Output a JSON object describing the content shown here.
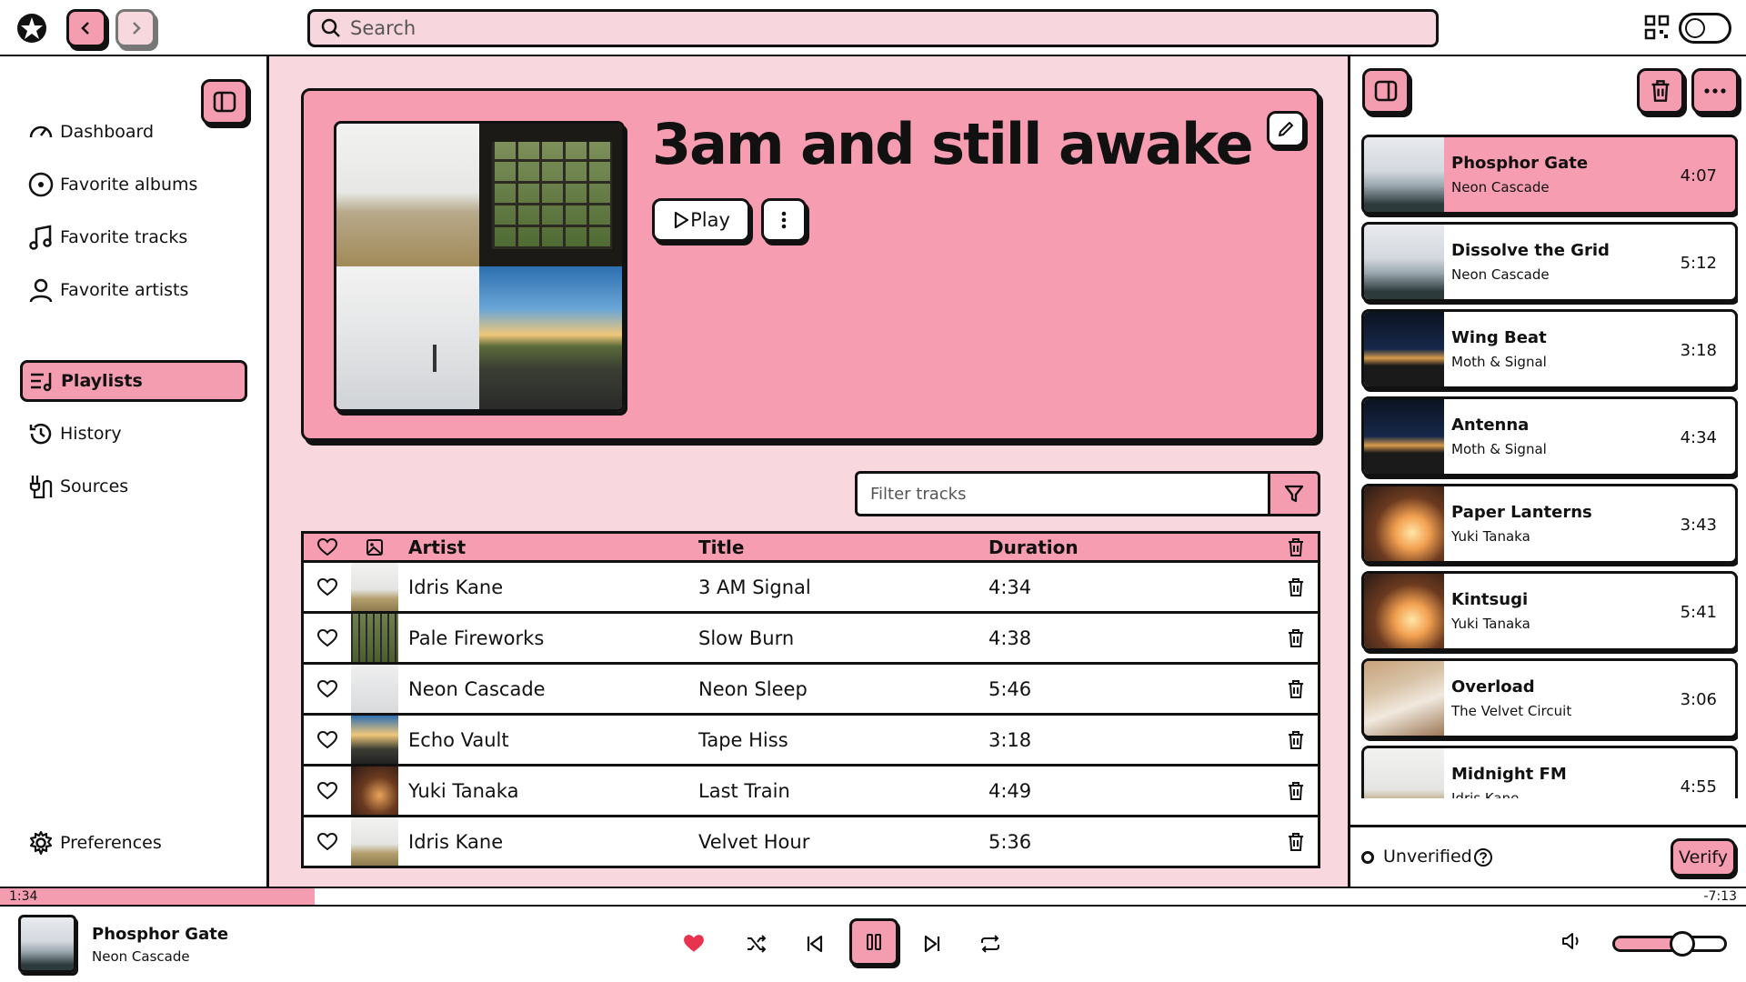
{
  "nav": {
    "search_placeholder": "Search"
  },
  "sidebar": {
    "items": [
      {
        "label": "Dashboard",
        "icon": "gauge-icon"
      },
      {
        "label": "Favorite albums",
        "icon": "disc-icon"
      },
      {
        "label": "Favorite tracks",
        "icon": "music-note-icon"
      },
      {
        "label": "Favorite artists",
        "icon": "user-icon"
      },
      {
        "label": "Playlists",
        "icon": "playlist-icon",
        "active": true
      },
      {
        "label": "History",
        "icon": "history-icon"
      },
      {
        "label": "Sources",
        "icon": "sources-icon"
      }
    ],
    "preferences_label": "Preferences"
  },
  "playlist": {
    "title": "3am and still awake",
    "play_label": "Play",
    "filter_placeholder": "Filter tracks"
  },
  "table": {
    "headers": {
      "artist": "Artist",
      "title": "Title",
      "duration": "Duration"
    },
    "rows": [
      {
        "artist": "Idris Kane",
        "title": "3 AM Signal",
        "duration": "4:34",
        "art": "grass"
      },
      {
        "artist": "Pale Fireworks",
        "title": "Slow Burn",
        "duration": "4:38",
        "art": "window"
      },
      {
        "artist": "Neon Cascade",
        "title": "Neon Sleep",
        "duration": "5:46",
        "art": "fog"
      },
      {
        "artist": "Echo Vault",
        "title": "Tape Hiss",
        "duration": "3:18",
        "art": "road"
      },
      {
        "artist": "Yuki Tanaka",
        "title": "Last Train",
        "duration": "4:49",
        "art": "ember"
      },
      {
        "artist": "Idris Kane",
        "title": "Velvet Hour",
        "duration": "5:36",
        "art": "grass"
      }
    ]
  },
  "queue": {
    "items": [
      {
        "title": "Phosphor Gate",
        "artist": "Neon Cascade",
        "duration": "4:07",
        "art": "mist",
        "active": true
      },
      {
        "title": "Dissolve the Grid",
        "artist": "Neon Cascade",
        "duration": "5:12",
        "art": "mist"
      },
      {
        "title": "Wing Beat",
        "artist": "Moth & Signal",
        "duration": "3:18",
        "art": "night"
      },
      {
        "title": "Antenna",
        "artist": "Moth & Signal",
        "duration": "4:34",
        "art": "night"
      },
      {
        "title": "Paper Lanterns",
        "artist": "Yuki Tanaka",
        "duration": "3:43",
        "art": "fire"
      },
      {
        "title": "Kintsugi",
        "artist": "Yuki Tanaka",
        "duration": "5:41",
        "art": "fire"
      },
      {
        "title": "Overload",
        "artist": "The Velvet Circuit",
        "duration": "3:06",
        "art": "hands"
      },
      {
        "title": "Midnight FM",
        "artist": "Idris Kane",
        "duration": "4:55",
        "art": "grass"
      }
    ],
    "status_label": "Unverified",
    "verify_label": "Verify"
  },
  "player": {
    "elapsed": "1:34",
    "remaining": "-7:13",
    "progress_fraction": 0.18,
    "title": "Phosphor Gate",
    "artist": "Neon Cascade",
    "liked": true,
    "volume_fraction": 0.62
  },
  "colors": {
    "accent": "#f49cb0",
    "accent_light": "#f9d7de",
    "border": "#111111",
    "heart": "#e8334f"
  }
}
